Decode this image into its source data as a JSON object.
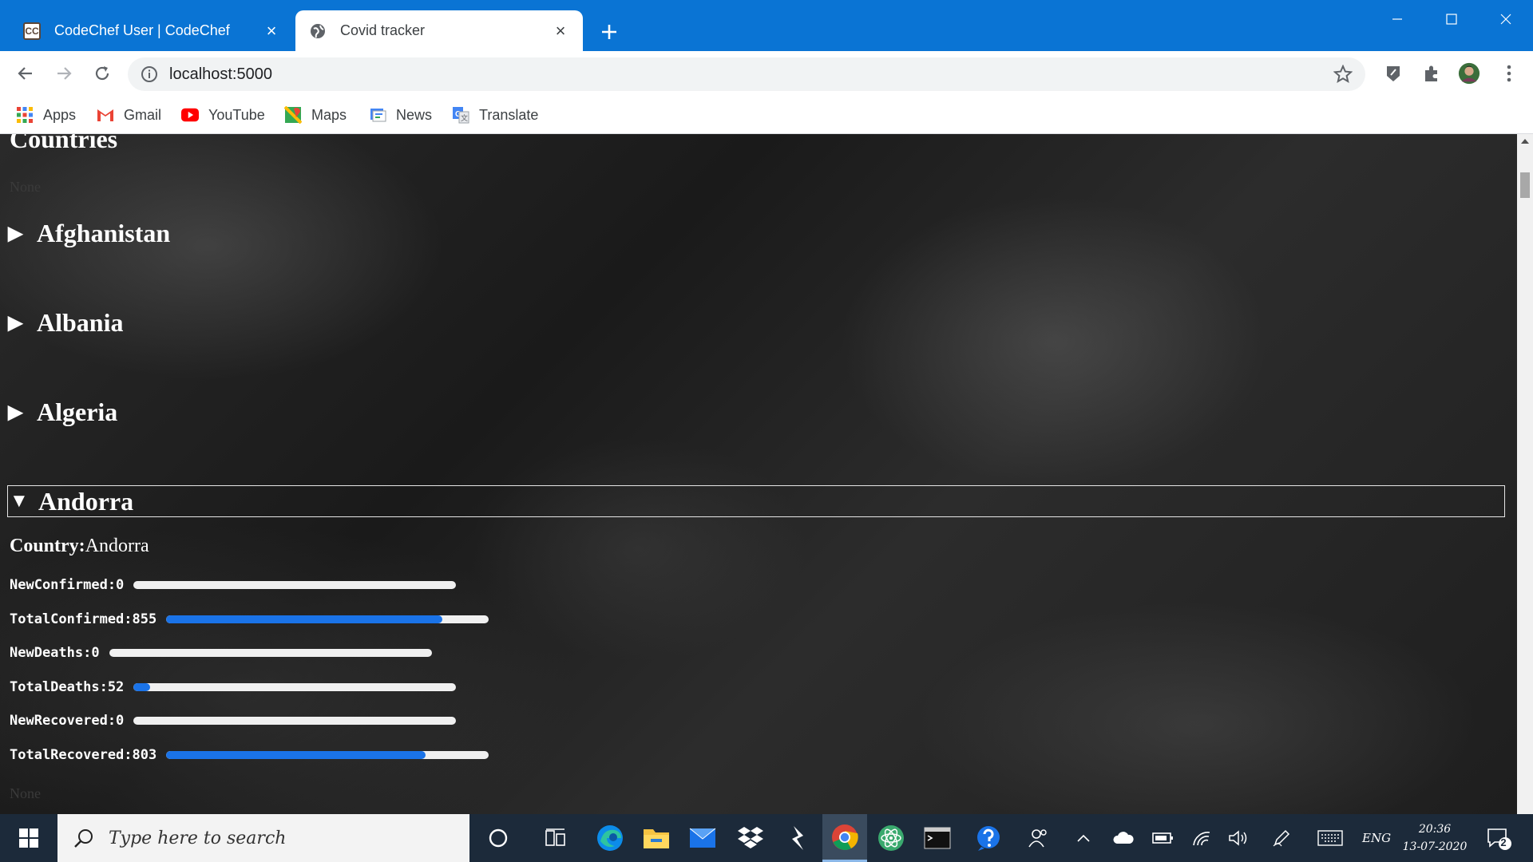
{
  "browser": {
    "tabs": [
      {
        "title": "CodeChef User | CodeChef",
        "favicon": "codechef-icon",
        "active": false
      },
      {
        "title": "Covid tracker",
        "favicon": "globe-icon",
        "active": true
      }
    ],
    "new_tab_icon": "plus-icon",
    "url": "localhost:5000",
    "bookmarks": [
      {
        "label": "Apps",
        "icon": "apps-grid-icon"
      },
      {
        "label": "Gmail",
        "icon": "gmail-icon"
      },
      {
        "label": "YouTube",
        "icon": "youtube-icon"
      },
      {
        "label": "Maps",
        "icon": "maps-icon"
      },
      {
        "label": "News",
        "icon": "news-icon"
      },
      {
        "label": "Translate",
        "icon": "translate-icon"
      }
    ]
  },
  "page": {
    "heading": "Countries",
    "dim_text_top": "None",
    "dim_text_bottom": "None",
    "countries": [
      {
        "name": "Afghanistan",
        "expanded": false
      },
      {
        "name": "Albania",
        "expanded": false
      },
      {
        "name": "Algeria",
        "expanded": false
      },
      {
        "name": "Andorra",
        "expanded": true
      }
    ],
    "details": {
      "country_label": "Country:",
      "country_value": "Andorra",
      "stats": [
        {
          "label": "NewConfirmed:0",
          "fraction": 0.0
        },
        {
          "label": "TotalConfirmed:855",
          "fraction": 0.855
        },
        {
          "label": "NewDeaths:0",
          "fraction": 0.0
        },
        {
          "label": "TotalDeaths:52",
          "fraction": 0.052
        },
        {
          "label": "NewRecovered:0",
          "fraction": 0.0
        },
        {
          "label": "TotalRecovered:803",
          "fraction": 0.803
        }
      ]
    }
  },
  "taskbar": {
    "search_placeholder": "Type here to search",
    "language": "ENG",
    "time": "20:36",
    "date": "13-07-2020",
    "notification_count": "2"
  },
  "colors": {
    "titlebar": "#0a74d4",
    "progress_fill": "#1a73e8",
    "progress_track": "#f0f0f0",
    "taskbar": "#1c2a3a"
  }
}
